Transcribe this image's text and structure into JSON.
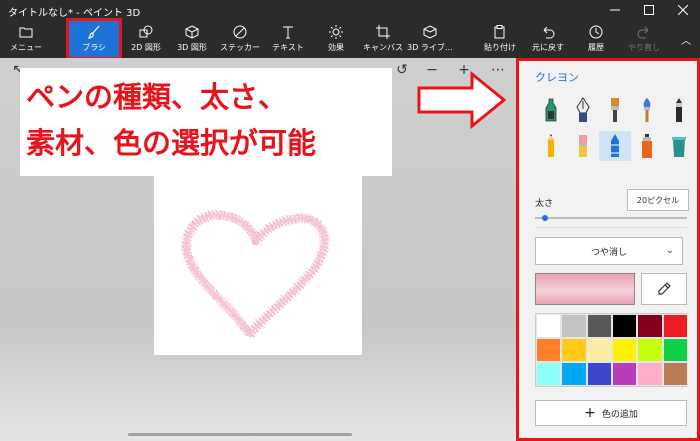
{
  "window": {
    "title": "タイトルなし* - ペイント 3D"
  },
  "ribbon": {
    "items": [
      {
        "label": "メニュー",
        "icon": "folder-icon"
      },
      {
        "label": "ブラシ",
        "icon": "brush-icon"
      },
      {
        "label": "2D 図形",
        "icon": "2d-shapes-icon"
      },
      {
        "label": "3D 図形",
        "icon": "3d-shapes-icon"
      },
      {
        "label": "ステッカー",
        "icon": "sticker-icon"
      },
      {
        "label": "テキスト",
        "icon": "text-icon"
      },
      {
        "label": "効果",
        "icon": "effects-icon"
      },
      {
        "label": "キャンバス",
        "icon": "canvas-icon"
      },
      {
        "label": "3D ライブ…",
        "icon": "3d-library-icon"
      },
      {
        "label": "貼り付け",
        "icon": "paste-icon"
      },
      {
        "label": "元に戻す",
        "icon": "undo-icon"
      },
      {
        "label": "履歴",
        "icon": "history-icon"
      },
      {
        "label": "やり直し",
        "icon": "redo-icon"
      }
    ],
    "active": "ブラシ"
  },
  "callout": {
    "line1": "ペンの種類、太さ、",
    "line2": "素材、色の選択が可能"
  },
  "panel": {
    "title": "クレヨン",
    "thickness_label": "太さ",
    "thickness_value": "20ピクセル",
    "thickness_level": 0.05,
    "finish": "つや消し",
    "add_color_label": "色の追加",
    "brushes": [
      "marker-icon",
      "calligraphy-pen-icon",
      "oil-brush-icon",
      "watercolor-icon",
      "pixel-pen-icon",
      "pencil-icon",
      "eraser-icon",
      "crayon-icon",
      "spray-can-icon",
      "fill-bucket-icon"
    ],
    "selected_brush": 7,
    "current_color": "#e8a2b3",
    "palette": [
      "#ffffff",
      "#c3c3c3",
      "#585858",
      "#000000",
      "#88001b",
      "#ec1c24",
      "#ff7f27",
      "#ffca18",
      "#fdeca6",
      "#fff200",
      "#c4ff0e",
      "#0ed145",
      "#8cfffb",
      "#00a8f3",
      "#3f48cc",
      "#b83dba",
      "#ffaec8",
      "#b97a56"
    ]
  }
}
